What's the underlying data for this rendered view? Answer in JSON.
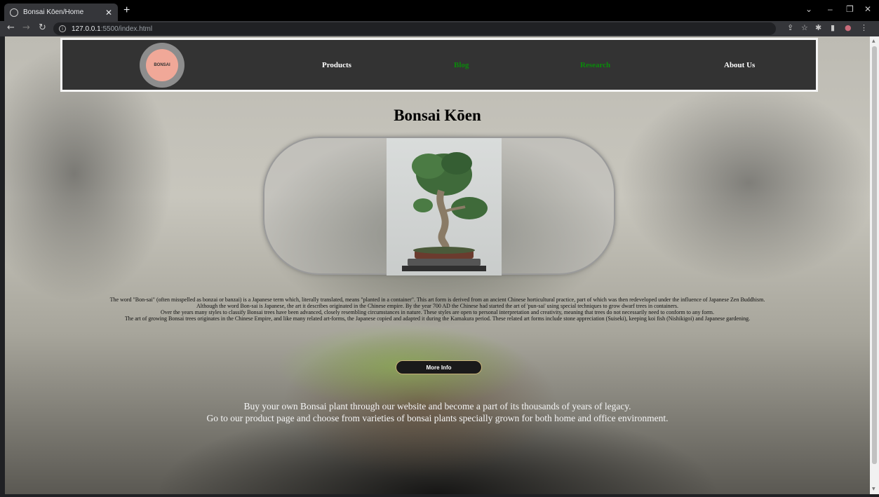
{
  "browser": {
    "tab_title": "Bonsai Kōen/Home",
    "tab_close": "✕",
    "new_tab": "+",
    "url_host": "127.0.0.1",
    "url_path": ":5500/index.html",
    "window_controls": [
      "⌄",
      "–",
      "❐",
      "✕"
    ]
  },
  "nav": {
    "logo_text": "BONSAI",
    "links": [
      {
        "label": "Products",
        "color": "#ffffff"
      },
      {
        "label": "Blog",
        "color": "#0a8a0a"
      },
      {
        "label": "Research",
        "color": "#0a8a0a"
      },
      {
        "label": "About Us",
        "color": "#ffffff"
      }
    ]
  },
  "main": {
    "title": "Bonsai Kōen",
    "paragraphs": [
      "The word \"Bon-sai\" (often misspelled as bonzai or banzai) is a Japanese term which, literally translated, means \"planted in a container\". This art form is derived from an ancient Chinese horticultural practice, part of which was then redeveloped under the influence of Japanese Zen Buddhism.",
      "Although the word Bon-sai is Japanese, the art it describes originated in the Chinese empire. By the year 700 AD the Chinese had started the art of 'pun-sai' using special techniques to grow dwarf trees in containers.",
      "Over the years many styles to classify Bonsai trees have been advanced, closely resembling circumstances in nature. These styles are open to personal interpretation and creativity, meaning that trees do not necessarily need to conform to any form.",
      "The art of growing Bonsai trees originates in the Chinese Empire, and like many related art-forms, the Japanese copied and adapted it during the Kamakura period. These related art forms include stone appreciation (Suiseki), keeping koi fish (Nishikigoi) and Japanese gardening."
    ],
    "button_label": "More Info",
    "cta_lines": [
      "Buy your own Bonsai plant through our website and become a part of its thousands of years of legacy.",
      "Go to our product page and choose from varieties of bonsai plants specially grown for both home and office environment."
    ]
  }
}
